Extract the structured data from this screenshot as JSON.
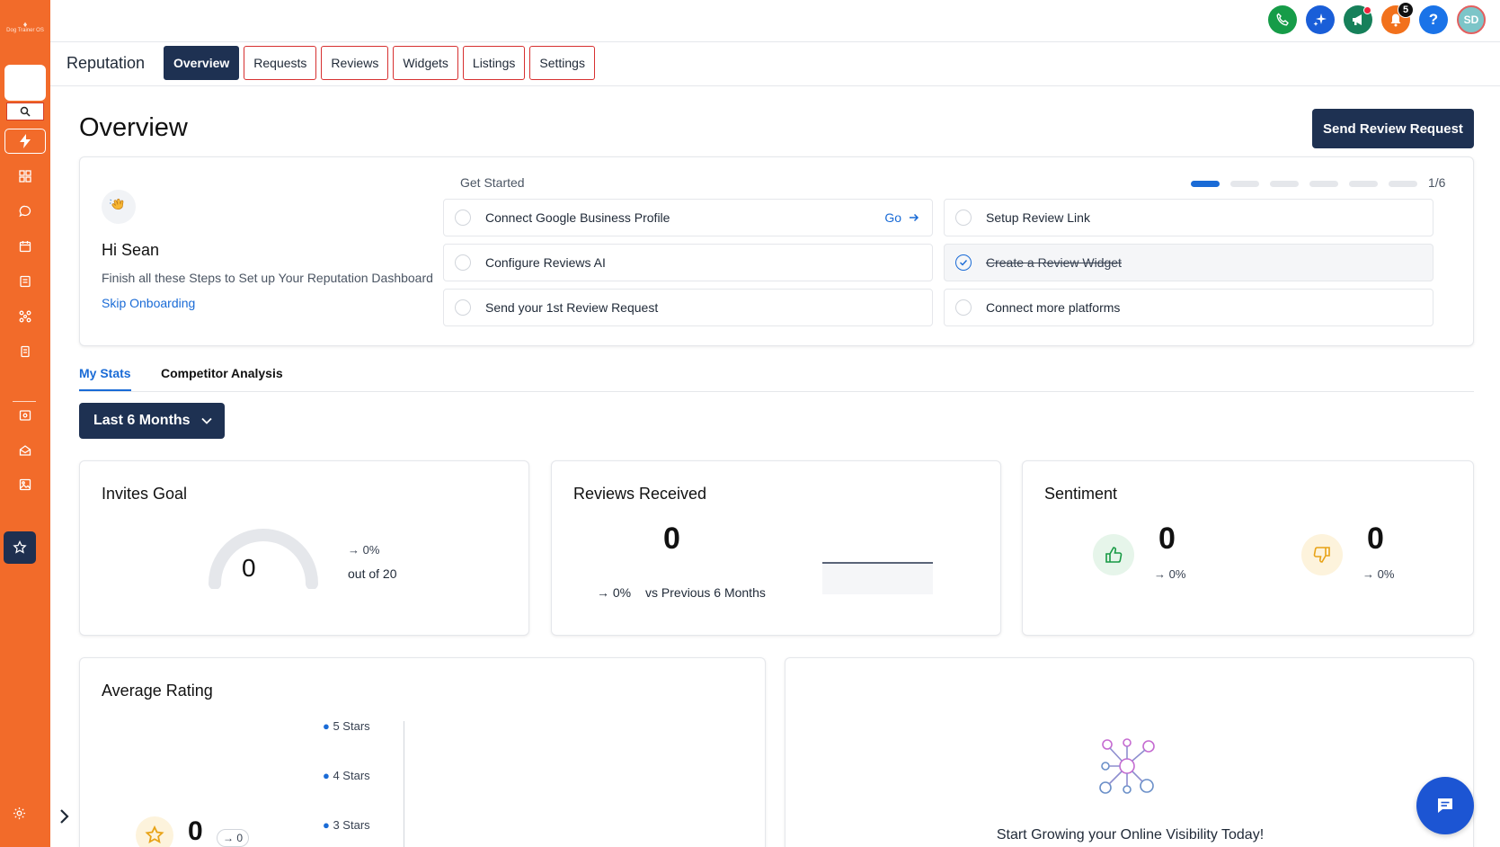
{
  "sidebar": {
    "brand_text": "Dog Trainer OS",
    "items": [
      "dashboard-icon",
      "chat-icon",
      "calendar-icon",
      "contacts-icon",
      "automation-icon",
      "documents-icon",
      "sites-icon",
      "email-icon",
      "media-icon",
      "star-icon"
    ],
    "active_item": "star-icon"
  },
  "topbar": {
    "notifications_count": "5",
    "avatar_initials": "SD",
    "help_glyph": "?"
  },
  "nav": {
    "title": "Reputation",
    "tabs": [
      "Overview",
      "Requests",
      "Reviews",
      "Widgets",
      "Listings",
      "Settings"
    ],
    "active_tab": "Overview"
  },
  "page": {
    "title": "Overview",
    "send_button": "Send Review Request"
  },
  "onboarding": {
    "greeting": "Hi Sean",
    "subtitle": "Finish all these Steps to Set up Your Reputation Dashboard",
    "skip_link": "Skip Onboarding",
    "get_started_label": "Get Started",
    "progress_text": "1/6",
    "progress_steps_total": 6,
    "progress_steps_done": 1,
    "go_label": "Go",
    "steps": [
      {
        "label": "Connect Google Business Profile",
        "done": false
      },
      {
        "label": "Setup Review Link",
        "done": false
      },
      {
        "label": "Configure Reviews AI",
        "done": false
      },
      {
        "label": "Create a Review Widget",
        "done": true
      },
      {
        "label": "Send your 1st Review Request",
        "done": false
      },
      {
        "label": "Connect more platforms",
        "done": false
      }
    ]
  },
  "stats_tabs": {
    "tabs": [
      "My Stats",
      "Competitor Analysis"
    ],
    "active": "My Stats"
  },
  "range_select": {
    "value": "Last 6 Months"
  },
  "invites_goal": {
    "title": "Invites Goal",
    "value": "0",
    "change": "0%",
    "out_of": "out of 20"
  },
  "reviews_received": {
    "title": "Reviews Received",
    "value": "0",
    "change": "0%",
    "comparison": "vs Previous 6 Months"
  },
  "sentiment": {
    "title": "Sentiment",
    "positive_value": "0",
    "positive_change": "0%",
    "negative_value": "0",
    "negative_change": "0%"
  },
  "average_rating": {
    "title": "Average Rating",
    "value": "0",
    "change": "0",
    "star_rows": [
      "5 Stars",
      "4 Stars",
      "3 Stars"
    ]
  },
  "growth": {
    "headline": "Start Growing your Online Visibility Today!"
  },
  "colors": {
    "sidebar": "#f26b2a",
    "primary_navy": "#1e3152",
    "accent_blue": "#1a6bd6",
    "tab_border": "#d73030"
  }
}
